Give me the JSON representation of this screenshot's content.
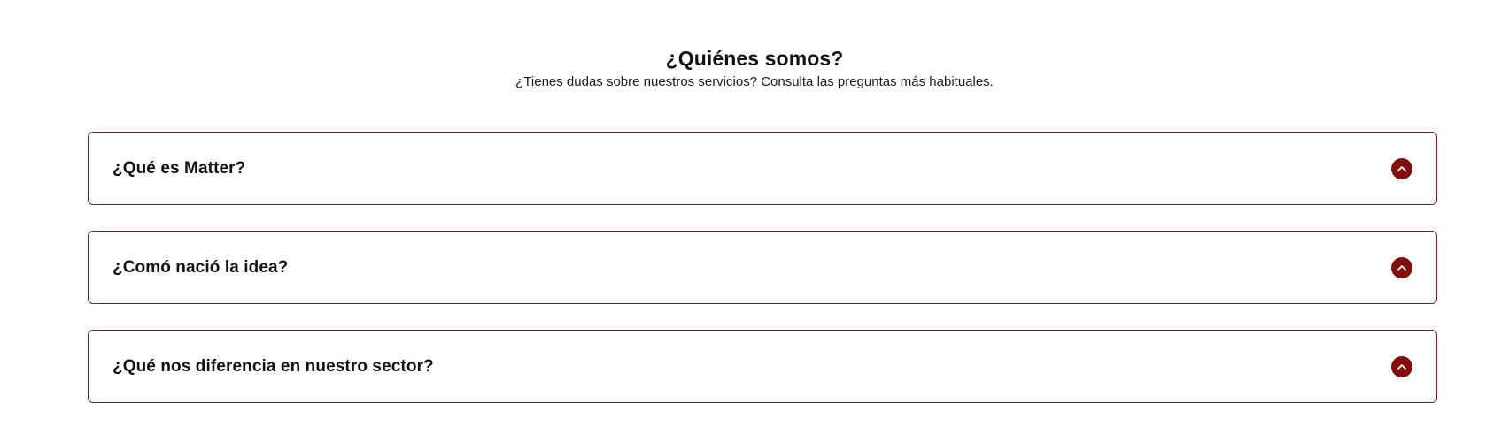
{
  "section": {
    "title": "¿Quiénes somos?",
    "subtitle": "¿Tienes dudas sobre nuestros servicios? Consulta las preguntas más habituales."
  },
  "faq": {
    "items": [
      {
        "question": "¿Qué es Matter?",
        "icon": "chevron-up-icon"
      },
      {
        "question": "¿Comó nació la idea?",
        "icon": "chevron-up-icon"
      },
      {
        "question": "¿Qué nos diferencia en nuestro sector?",
        "icon": "chevron-up-icon"
      }
    ]
  },
  "colors": {
    "accent": "#7f0e0e",
    "border": "#8b1a24",
    "text": "#111111",
    "background": "#ffffff"
  }
}
